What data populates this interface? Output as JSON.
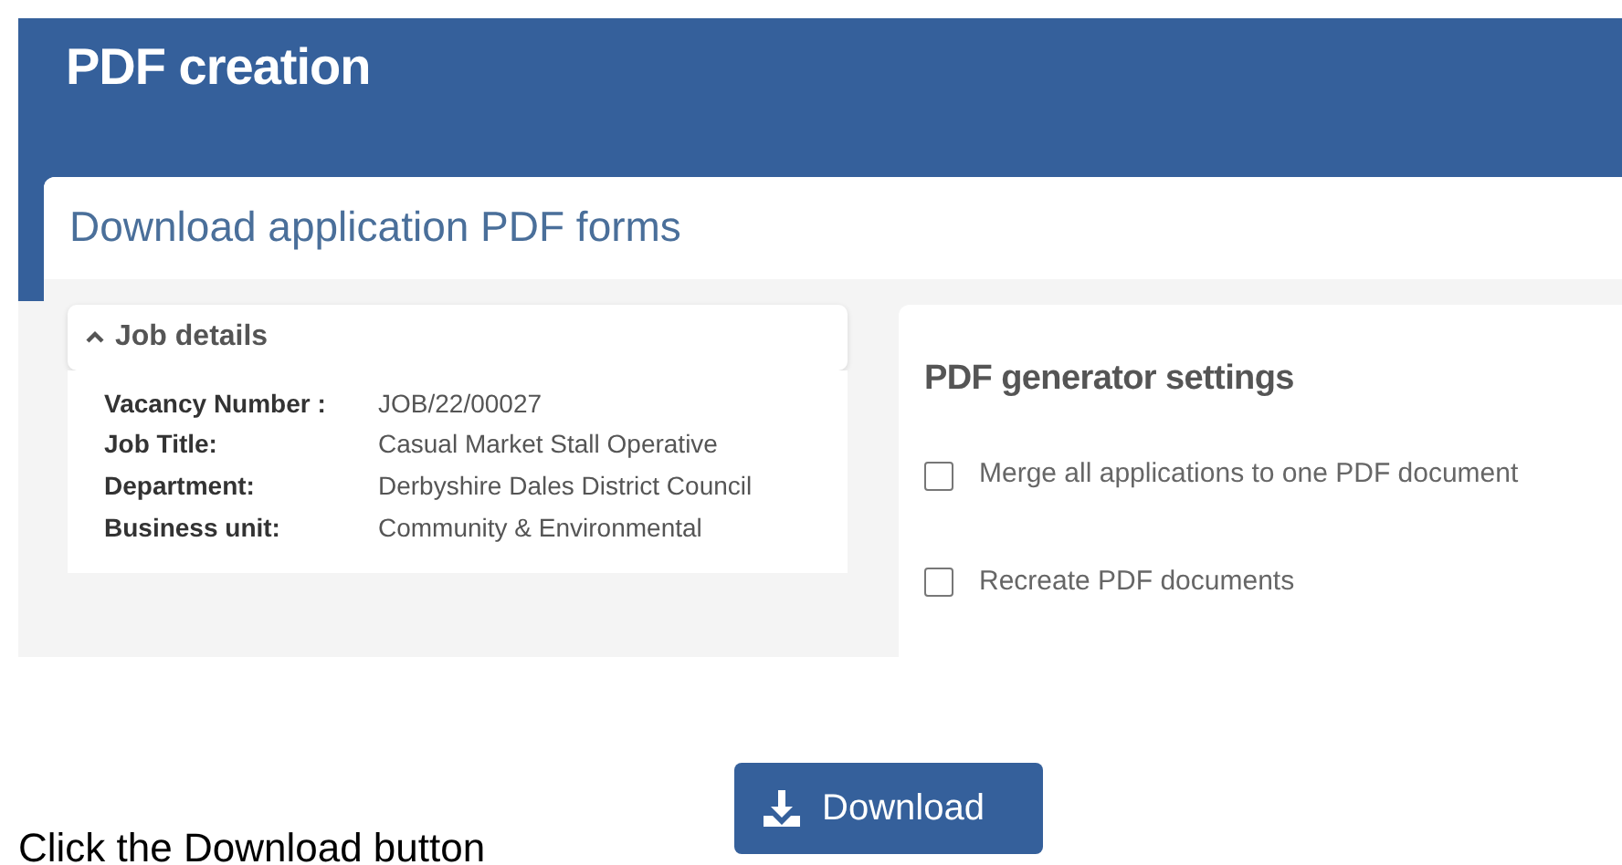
{
  "header": {
    "title": "PDF creation"
  },
  "page_title": "Download application PDF forms",
  "job_details": {
    "title": "Job details",
    "expanded": true,
    "fields": [
      {
        "label": "Vacancy Number :",
        "value": "JOB/22/00027"
      },
      {
        "label": "Job Title:",
        "value": "Casual Market Stall Operative"
      },
      {
        "label": "Department:",
        "value": "Derbyshire Dales District Council"
      },
      {
        "label": "Business unit:",
        "value": "Community & Environmental"
      }
    ]
  },
  "settings": {
    "title": "PDF generator settings",
    "options": [
      {
        "label": "Merge all applications to one PDF document",
        "checked": false
      },
      {
        "label": "Recreate PDF documents",
        "checked": false
      }
    ]
  },
  "instruction": "Click the Download button",
  "download_button": "Download"
}
